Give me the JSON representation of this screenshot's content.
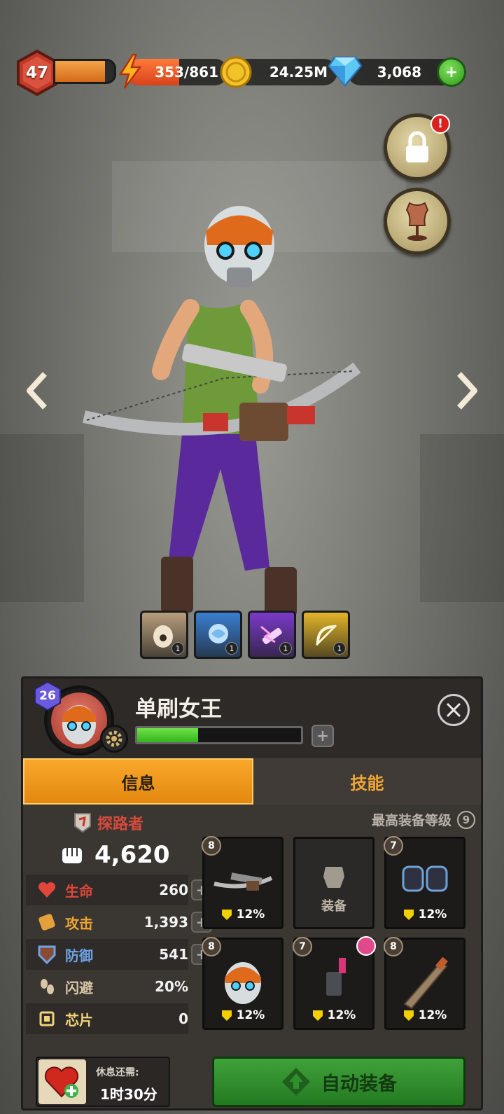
{
  "hud": {
    "player_level": "47",
    "xp_progress": 0.85,
    "energy": "353/861",
    "coins": "24.25M",
    "gems": "3,068",
    "add_gems_label": "+"
  },
  "side_buttons": {
    "lock_alert": "!"
  },
  "skills": [
    {
      "name": "focus-skill-icon",
      "level": "1",
      "color": "#b89e7c"
    },
    {
      "name": "brain-skill-icon",
      "level": "1",
      "color": "#3a7fd1"
    },
    {
      "name": "syringe-skill-icon",
      "level": "1",
      "color": "#7a3ac9"
    },
    {
      "name": "bow-skill-icon",
      "level": "1",
      "color": "#e2b52a"
    }
  ],
  "hero": {
    "rank": "26",
    "name": "单刷女王",
    "progress": 0.37,
    "plus_label": "+"
  },
  "tabs": {
    "info": "信息",
    "skills": "技能"
  },
  "stats": {
    "class_name": "探路者",
    "power": "4,620",
    "rows": [
      {
        "label": "生命",
        "value": "260",
        "color": "#e0463a"
      },
      {
        "label": "攻击",
        "value": "1,393",
        "color": "#f0a533"
      },
      {
        "label": "防御",
        "value": "541",
        "color": "#6ea3e6"
      },
      {
        "label": "闪避",
        "value": "20%",
        "color": "#d9c6a6"
      },
      {
        "label": "芯片",
        "value": "0",
        "color": "#f2d37a"
      }
    ],
    "plus_label": "+"
  },
  "equipment": {
    "max_level_label": "最高装备等级",
    "max_level": "9",
    "slots": [
      {
        "level": "8",
        "bonus": "12%"
      },
      {
        "empty_label": "装备"
      },
      {
        "level": "7",
        "bonus": "12%"
      },
      {
        "level": "8",
        "bonus": "12%"
      },
      {
        "level": "7",
        "bonus": "12%"
      },
      {
        "level": "8",
        "bonus": "12%"
      }
    ]
  },
  "footer": {
    "rest_label": "休息还需:",
    "rest_time": "1时30分",
    "auto_equip": "自动装备"
  }
}
